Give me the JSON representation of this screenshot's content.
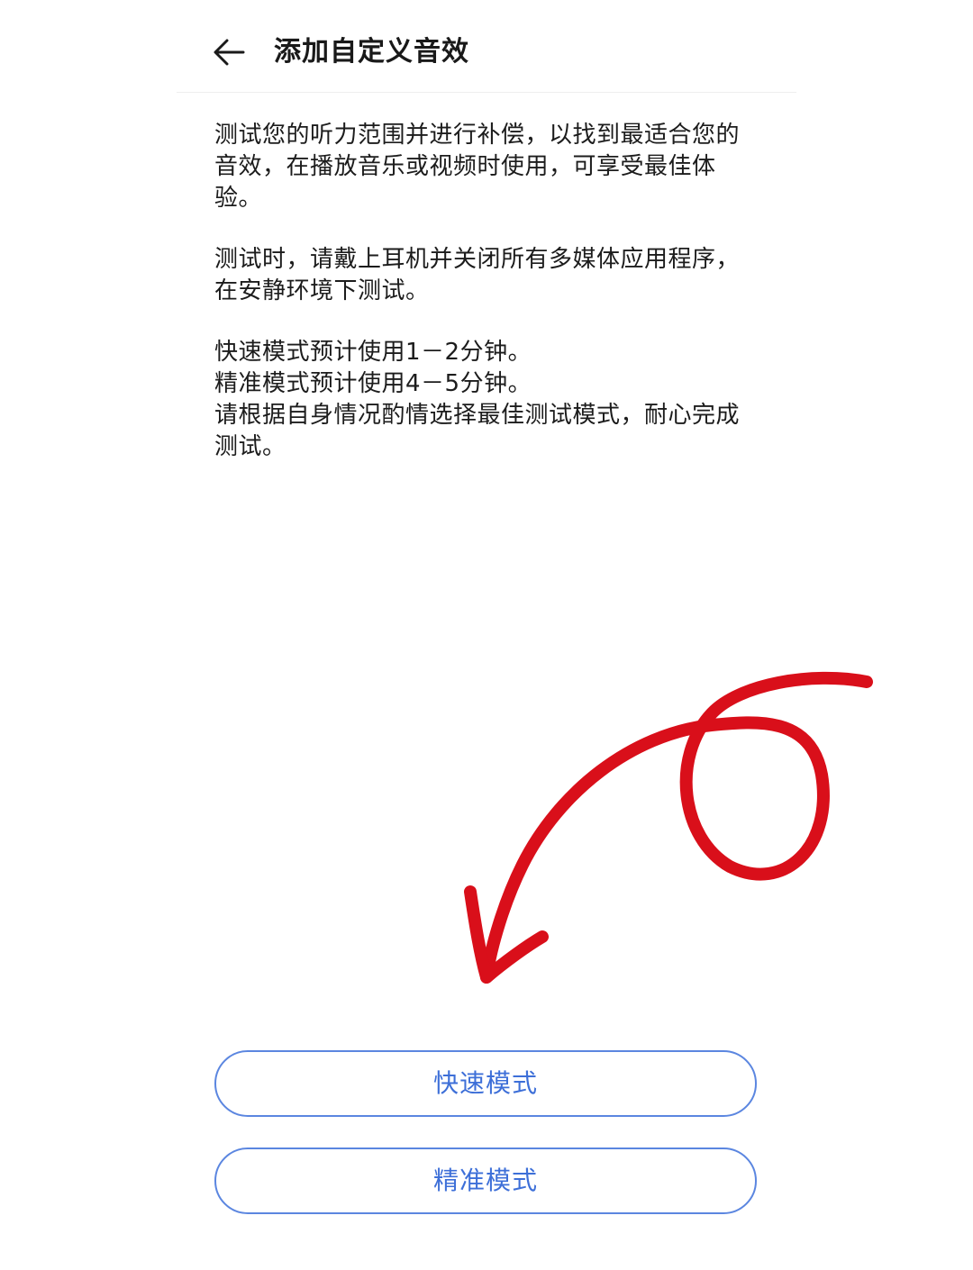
{
  "header": {
    "title": "添加自定义音效",
    "back_icon": "arrow-left-icon"
  },
  "content": {
    "paragraphs": [
      "测试您的听力范围并进行补偿，以找到最适合您的\n音效，在播放音乐或视频时使用，可享受最佳体\n验。",
      "测试时，请戴上耳机并关闭所有多媒体应用程序，\n在安静环境下测试。",
      "快速模式预计使用1－2分钟。\n精准模式预计使用4－5分钟。\n请根据自身情况酌情选择最佳测试模式，耐心完成\n测试。"
    ]
  },
  "buttons": {
    "quick_mode": "快速模式",
    "precise_mode": "精准模式"
  },
  "colors": {
    "accent": "#3d6fd8",
    "annotation": "#d90f1a"
  }
}
